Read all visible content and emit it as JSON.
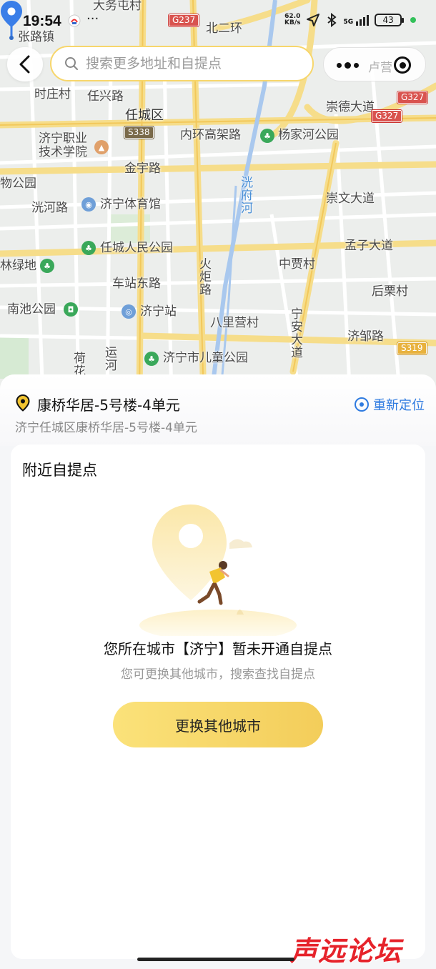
{
  "status_bar": {
    "time": "19:54",
    "net_speed_value": "62.0",
    "net_speed_unit": "KB/s",
    "network": "5G",
    "battery": "43"
  },
  "toolbar": {
    "search_placeholder": "搜索更多地址和自提点",
    "capsule_hint": "卢营"
  },
  "map": {
    "labels": {
      "dawutun": "大务屯村",
      "zhangluzhen": "张路镇",
      "beierhuan": "北二环",
      "shizhuangcun": "时庄村",
      "renxinglu": "任兴路",
      "renchengqu": "任城区",
      "jining_college_1": "济宁职业",
      "jining_college_2": "技术学院",
      "neihuan": "内环高架路",
      "yangjiahe": "杨家河公园",
      "chongde": "崇德大道",
      "jinyulu": "金宇路",
      "wugongyuan": "物公园",
      "guangfuhe": "洸府河",
      "guanghelu": "洸河路",
      "stadium": "济宁体育馆",
      "chongwen": "崇文大道",
      "renmin_park": "任城人民公园",
      "mengzi": "孟子大道",
      "linlvdi": "林绿地",
      "huojulu": "火炬路",
      "zhongjia": "中贾村",
      "chezhandong": "车站东路",
      "houli": "后栗村",
      "nanchi": "南池公园",
      "jining_station": "济宁站",
      "balingying": "八里营村",
      "ningan": "宁安大道",
      "jizou": "济邹路",
      "hehua": "荷花",
      "yunhe": "运河",
      "children_park": "济宁市儿童公园"
    },
    "shields": {
      "g237": "G237",
      "g327_a": "G327",
      "g327_b": "G327",
      "s338": "S338",
      "s319": "S319"
    }
  },
  "address": {
    "title": "康桥华居-5号楼-4单元",
    "full": "济宁任城区康桥华居-5号楼-4单元",
    "relocate_label": "重新定位"
  },
  "nearby": {
    "title": "附近自提点",
    "empty_title": "您所在城市【济宁】暂未开通自提点",
    "empty_sub": "您可更换其他城市，搜索查找自提点",
    "switch_button": "更换其他城市"
  },
  "watermark": "声远论坛",
  "colors": {
    "accent_yellow": "#f7d66b",
    "link_blue": "#2f7be0",
    "pin_blue": "#3a7ee8"
  }
}
